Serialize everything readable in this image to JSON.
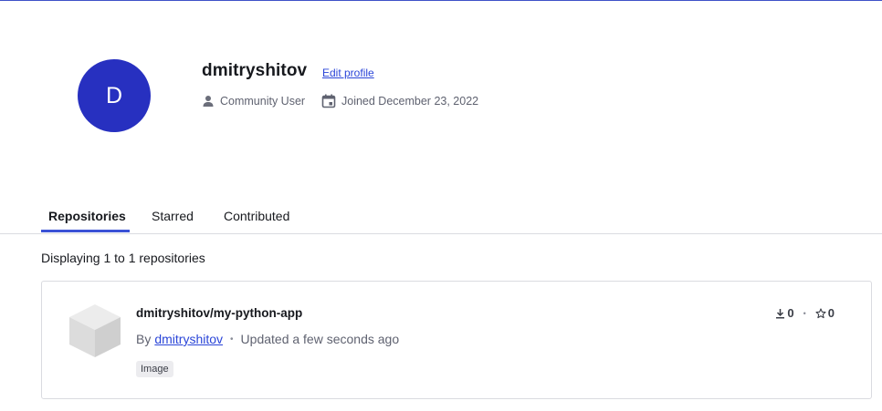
{
  "profile": {
    "avatar_initial": "D",
    "username": "dmitryshitov",
    "edit_label": "Edit profile",
    "role": "Community User",
    "joined": "Joined December 23, 2022"
  },
  "tabs": [
    {
      "label": "Repositories",
      "active": true
    },
    {
      "label": "Starred",
      "active": false
    },
    {
      "label": "Contributed",
      "active": false
    }
  ],
  "results": {
    "summary": "Displaying 1 to 1 repositories"
  },
  "repositories": [
    {
      "name": "dmitryshitov/my-python-app",
      "by_label": "By",
      "owner": "dmitryshitov",
      "updated": "Updated a few seconds ago",
      "badge": "Image",
      "downloads": "0",
      "stars": "0"
    }
  ],
  "colors": {
    "accent": "#2730c0",
    "link": "#2a45d8",
    "tab_underline": "#3a52d6"
  },
  "icons": {
    "role": "person-icon",
    "joined": "calendar-icon",
    "repo": "cube-icon",
    "downloads": "download-icon",
    "stars": "star-icon"
  }
}
